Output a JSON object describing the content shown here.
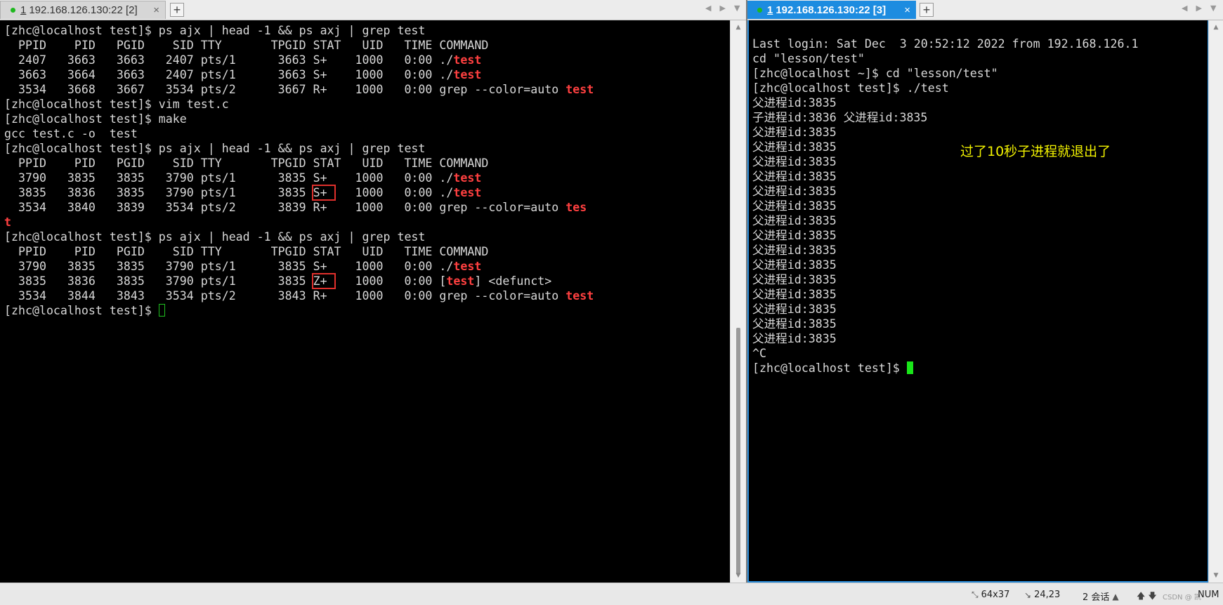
{
  "left_pane": {
    "tab": {
      "number": "1",
      "title": "192.168.126.130:22 [2]",
      "close": "×"
    },
    "add_tab": "+",
    "nav": {
      "prev": "◀",
      "next": "▶",
      "menu": "▼"
    },
    "terminal": {
      "lines": [
        {
          "segments": [
            {
              "text": "[zhc@localhost test]$ ps ajx | head -1 && ps axj | grep test"
            }
          ]
        },
        {
          "segments": [
            {
              "text": "  PPID    PID   PGID    SID TTY       TPGID STAT   UID   TIME COMMAND"
            }
          ]
        },
        {
          "segments": [
            {
              "text": "  2407   3663   3663   2407 pts/1      3663 S+    1000   0:00 ./"
            },
            {
              "text": "test",
              "hl": true
            }
          ]
        },
        {
          "segments": [
            {
              "text": "  3663   3664   3663   2407 pts/1      3663 S+    1000   0:00 ./"
            },
            {
              "text": "test",
              "hl": true
            }
          ]
        },
        {
          "segments": [
            {
              "text": "  3534   3668   3667   3534 pts/2      3667 R+    1000   0:00 grep --color=auto "
            },
            {
              "text": "test",
              "hl": true
            }
          ]
        },
        {
          "segments": [
            {
              "text": "[zhc@localhost test]$ vim test.c"
            }
          ]
        },
        {
          "segments": [
            {
              "text": "[zhc@localhost test]$ make"
            }
          ]
        },
        {
          "segments": [
            {
              "text": "gcc test.c -o  test"
            }
          ]
        },
        {
          "segments": [
            {
              "text": "[zhc@localhost test]$ ps ajx | head -1 && ps axj | grep test"
            }
          ]
        },
        {
          "segments": [
            {
              "text": "  PPID    PID   PGID    SID TTY       TPGID STAT   UID   TIME COMMAND"
            }
          ]
        },
        {
          "segments": [
            {
              "text": "  3790   3835   3835   3790 pts/1      3835 S+    1000   0:00 ./"
            },
            {
              "text": "test",
              "hl": true
            }
          ]
        },
        {
          "segments": [
            {
              "text": "  3835   3836   3835   3790 pts/1      3835 "
            },
            {
              "text": "S+ ",
              "box": true
            },
            {
              "text": "   1000   0:00 ./"
            },
            {
              "text": "test",
              "hl": true
            }
          ]
        },
        {
          "segments": [
            {
              "text": "  3534   3840   3839   3534 pts/2      3839 R+    1000   0:00 grep --color=auto "
            },
            {
              "text": "tes",
              "hl": true
            }
          ]
        },
        {
          "segments": [
            {
              "text": "t",
              "hl": true
            }
          ]
        },
        {
          "segments": [
            {
              "text": "[zhc@localhost test]$ ps ajx | head -1 && ps axj | grep test"
            }
          ]
        },
        {
          "segments": [
            {
              "text": "  PPID    PID   PGID    SID TTY       TPGID STAT   UID   TIME COMMAND"
            }
          ]
        },
        {
          "segments": [
            {
              "text": "  3790   3835   3835   3790 pts/1      3835 S+    1000   0:00 ./"
            },
            {
              "text": "test",
              "hl": true
            }
          ]
        },
        {
          "segments": [
            {
              "text": "  3835   3836   3835   3790 pts/1      3835 "
            },
            {
              "text": "Z+ ",
              "box": true
            },
            {
              "text": "   1000   0:00 ["
            },
            {
              "text": "test",
              "hl": true
            },
            {
              "text": "] <defunct>"
            }
          ]
        },
        {
          "segments": [
            {
              "text": "  3534   3844   3843   3534 pts/2      3843 R+    1000   0:00 grep --color=auto "
            },
            {
              "text": "test",
              "hl": true
            }
          ]
        },
        {
          "segments": [
            {
              "text": "[zhc@localhost test]$ "
            }
          ],
          "cursor": "empty"
        }
      ]
    }
  },
  "right_pane": {
    "tab": {
      "number": "1",
      "title": "192.168.126.130:22 [3]",
      "close": "×"
    },
    "add_tab": "+",
    "nav": {
      "prev": "◀",
      "next": "▶",
      "menu": "▼"
    },
    "annotation": "过了10秒子进程就退出了",
    "terminal": {
      "lines": [
        {
          "segments": [
            {
              "text": "Last login: Sat Dec  3 20:52:12 2022 from 192.168.126.1"
            }
          ]
        },
        {
          "segments": [
            {
              "text": "cd \"lesson/test\""
            }
          ]
        },
        {
          "segments": [
            {
              "text": "[zhc@localhost ~]$ cd \"lesson/test\""
            }
          ]
        },
        {
          "segments": [
            {
              "text": "[zhc@localhost test]$ ./test"
            }
          ]
        },
        {
          "segments": [
            {
              "text": "父进程id:3835"
            }
          ]
        },
        {
          "segments": [
            {
              "text": "子进程id:3836 父进程id:3835"
            }
          ]
        },
        {
          "segments": [
            {
              "text": "父进程id:3835"
            }
          ]
        },
        {
          "segments": [
            {
              "text": "父进程id:3835"
            }
          ]
        },
        {
          "segments": [
            {
              "text": "父进程id:3835"
            }
          ]
        },
        {
          "segments": [
            {
              "text": "父进程id:3835"
            }
          ]
        },
        {
          "segments": [
            {
              "text": "父进程id:3835"
            }
          ]
        },
        {
          "segments": [
            {
              "text": "父进程id:3835"
            }
          ]
        },
        {
          "segments": [
            {
              "text": "父进程id:3835"
            }
          ]
        },
        {
          "segments": [
            {
              "text": "父进程id:3835"
            }
          ]
        },
        {
          "segments": [
            {
              "text": "父进程id:3835"
            }
          ]
        },
        {
          "segments": [
            {
              "text": "父进程id:3835"
            }
          ]
        },
        {
          "segments": [
            {
              "text": "父进程id:3835"
            }
          ]
        },
        {
          "segments": [
            {
              "text": "父进程id:3835"
            }
          ]
        },
        {
          "segments": [
            {
              "text": "父进程id:3835"
            }
          ]
        },
        {
          "segments": [
            {
              "text": "父进程id:3835"
            }
          ]
        },
        {
          "segments": [
            {
              "text": "父进程id:3835"
            }
          ]
        },
        {
          "segments": [
            {
              "text": "^C"
            }
          ]
        },
        {
          "segments": [
            {
              "text": "[zhc@localhost test]$ "
            }
          ],
          "cursor": "solid"
        }
      ]
    }
  },
  "status_bar": {
    "size": "64x37",
    "position": "24,23",
    "sessions": "2 会话",
    "session_arrow": "▲",
    "scroll_arrows": "🡅🡇",
    "num": "NUM",
    "watermark": "CSDN @ 凯"
  },
  "colors": {
    "highlight": "#ff4040",
    "box": "#e0302c",
    "active_tab": "#1d8ce0",
    "annotation": "#f3f300",
    "cursor": "#19e619"
  }
}
